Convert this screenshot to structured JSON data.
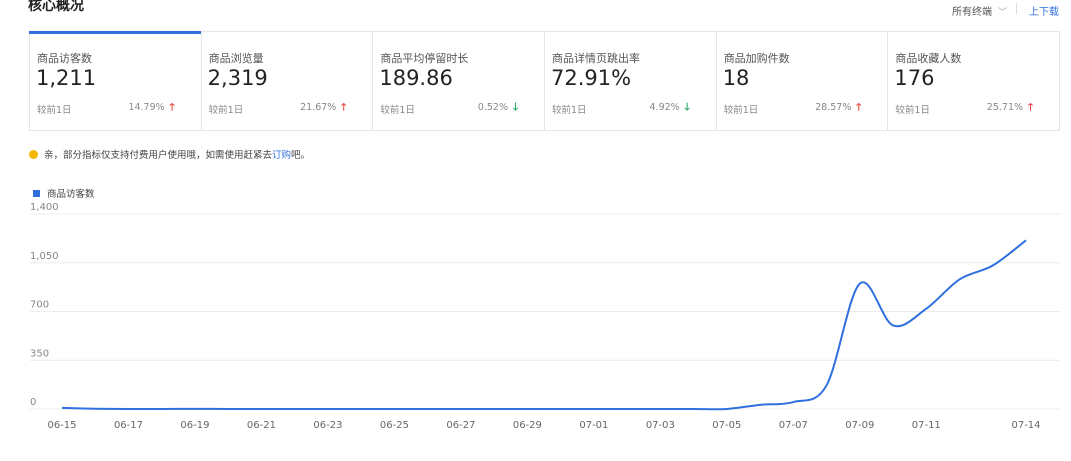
{
  "header": {
    "title": "核心概况",
    "filter_label": "所有终端",
    "download_label": "上下载"
  },
  "cards": [
    {
      "label": "商品访客数",
      "value": "1,211",
      "compare": "较前1日",
      "pct": "14.79%",
      "trend": "up"
    },
    {
      "label": "商品浏览量",
      "value": "2,319",
      "compare": "较前1日",
      "pct": "21.67%",
      "trend": "up"
    },
    {
      "label": "商品平均停留时长",
      "value": "189.86",
      "compare": "较前1日",
      "pct": "0.52%",
      "trend": "down"
    },
    {
      "label": "商品详情页跳出率",
      "value": "72.91%",
      "compare": "较前1日",
      "pct": "4.92%",
      "trend": "down"
    },
    {
      "label": "商品加购件数",
      "value": "18",
      "compare": "较前1日",
      "pct": "28.57%",
      "trend": "up"
    },
    {
      "label": "商品收藏人数",
      "value": "176",
      "compare": "较前1日",
      "pct": "25.71%",
      "trend": "up"
    }
  ],
  "notice": {
    "text": "亲，部分指标仅支持付费用户使用哦，如需使用赶紧去",
    "link": "订购",
    "suffix": "吧。"
  },
  "colors": {
    "accent": "#2f6fde",
    "up": "#e8433b",
    "down": "#1ea35e",
    "notice_dot": "#f5b800"
  },
  "chart_data": {
    "type": "line",
    "title": "",
    "xlabel": "",
    "ylabel": "",
    "ylim": [
      0,
      1400
    ],
    "yticks": [
      "0",
      "350",
      "700",
      "1,050",
      "1,400"
    ],
    "grid": true,
    "legend": "top-left",
    "x": [
      "06-15",
      "06-16",
      "06-17",
      "06-18",
      "06-19",
      "06-20",
      "06-21",
      "06-22",
      "06-23",
      "06-24",
      "06-25",
      "06-26",
      "06-27",
      "06-28",
      "06-29",
      "06-30",
      "07-01",
      "07-02",
      "07-03",
      "07-04",
      "07-05",
      "07-06",
      "07-07",
      "07-08",
      "07-09",
      "07-10",
      "07-11",
      "07-12",
      "07-13",
      "07-14"
    ],
    "xticks": [
      "06-15",
      "06-17",
      "06-19",
      "06-21",
      "06-23",
      "06-25",
      "06-27",
      "06-29",
      "07-01",
      "07-03",
      "07-05",
      "07-07",
      "07-09",
      "07-11",
      "07-14"
    ],
    "series": [
      {
        "name": "商品访客数",
        "values": [
          8,
          2,
          0,
          0,
          1,
          0,
          0,
          0,
          0,
          0,
          0,
          0,
          0,
          0,
          0,
          0,
          0,
          0,
          0,
          0,
          0,
          30,
          50,
          170,
          900,
          600,
          720,
          930,
          1030,
          1211
        ]
      }
    ]
  }
}
